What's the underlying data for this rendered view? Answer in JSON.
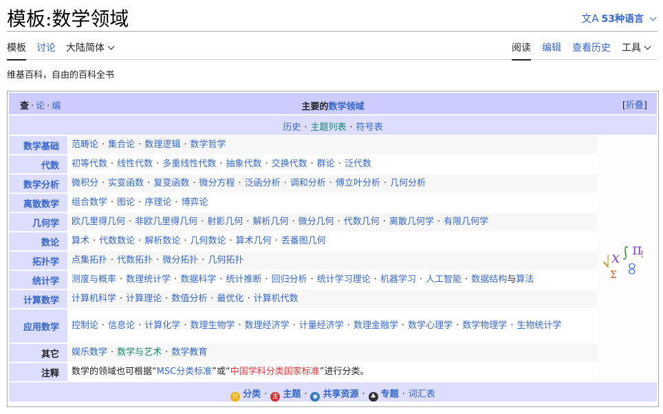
{
  "header": {
    "title": "模板:数学领域",
    "lang_icon": "文A",
    "lang_label": "53种语言"
  },
  "tabs": {
    "template": "模板",
    "talk": "讨论",
    "variant": "大陆简体",
    "read": "阅读",
    "edit": "编辑",
    "history": "查看历史",
    "tools": "工具"
  },
  "tagline": "维基百科，自由的百科全书",
  "navbox": {
    "vte": [
      "查",
      "论",
      "编"
    ],
    "title_prefix": "主要的",
    "title_link": "数学领域",
    "collapse_label": "折叠",
    "above": [
      {
        "text": "历史",
        "color": "blue"
      },
      {
        "text": "主题列表",
        "color": "green"
      },
      {
        "text": "符号表",
        "color": "blue"
      }
    ],
    "groups": [
      {
        "name": "数学基础",
        "items": [
          "范畴论",
          "集合论",
          "数理逻辑",
          "数学哲学"
        ]
      },
      {
        "name": "代数",
        "items": [
          "初等代数",
          "线性代数",
          "多重线性代数",
          "抽象代数",
          "交换代数",
          "群论",
          "泛代数"
        ]
      },
      {
        "name": "数学分析",
        "items": [
          "微积分",
          "实变函数",
          "复变函数",
          "微分方程",
          "泛函分析",
          "调和分析",
          "傅立叶分析",
          "几何分析"
        ]
      },
      {
        "name": "离散数学",
        "items": [
          "组合数学",
          "图论",
          "序理论",
          "博弈论"
        ]
      },
      {
        "name": "几何学",
        "items": [
          "欧几里得几何",
          "非欧几里得几何",
          "射影几何",
          "解析几何",
          "微分几何",
          "代数几何",
          "离散几何学",
          "有限几何学"
        ]
      },
      {
        "name": "数论",
        "items": [
          "算术",
          "代数数论",
          "解析数论",
          "几何数论",
          "算术几何",
          "丢番图几何"
        ]
      },
      {
        "name": "拓扑学",
        "items": [
          "点集拓扑",
          "代数拓扑",
          "微分拓扑",
          "几何拓扑"
        ]
      },
      {
        "name": "统计学",
        "items": [
          "测度与概率",
          "数理统计学",
          "数据科学",
          "统计推断",
          "回归分析",
          "统计学习理论",
          "机器学习",
          "人工智能",
          "数据结构与算法"
        ]
      },
      {
        "name": "计算数学",
        "items": [
          "计算机科学",
          "计算理论",
          "数值分析",
          "最优化",
          "计算机代数"
        ]
      },
      {
        "name": "应用数学",
        "items": [
          "控制论",
          "信息论",
          "计算化学",
          "数理生物学",
          "数理经济学",
          "计量经济学",
          "数理金融学",
          "数学心理学",
          "数学物理学",
          "生物统计学"
        ]
      },
      {
        "name": "其它",
        "items": [
          "娱乐数学",
          "数学与艺术",
          "数学教育"
        ]
      },
      {
        "name": "注释",
        "note": {
          "before": "数学的领域也可根据“",
          "link1": "MSC分类标准",
          "middle": "”或“",
          "link2": "中国学科分类国家标准",
          "after": "”进行分类。"
        }
      }
    ],
    "image_alt": "数学符号",
    "below": [
      {
        "icon": "category-icon",
        "text": "分类"
      },
      {
        "icon": "portal-icon",
        "text": "主题"
      },
      {
        "icon": "commons-icon",
        "text": "共享资源"
      },
      {
        "icon": "wikiproject-icon",
        "text": "专题"
      },
      {
        "icon": "",
        "text": "词汇表"
      }
    ]
  },
  "colors": {
    "link": "#3366cc",
    "green_link": "#14866d",
    "red_link": "#d33",
    "navbox_title_bg": "#ccccff",
    "navbox_group_bg": "#ddddff"
  }
}
